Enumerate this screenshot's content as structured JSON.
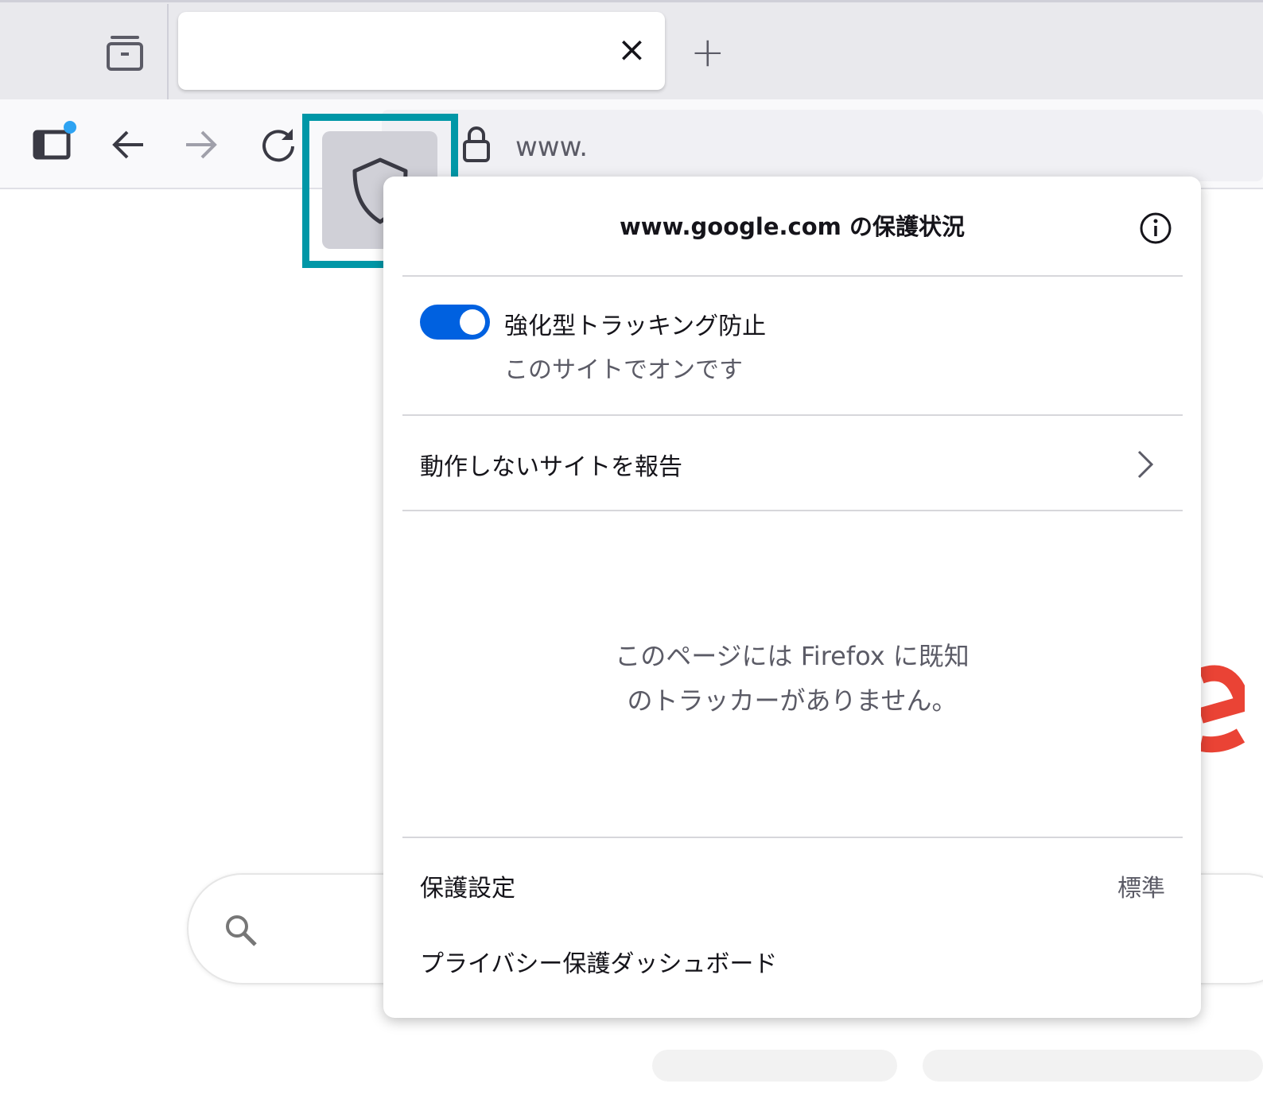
{
  "browser": {
    "tab": {
      "close_label": "×"
    },
    "new_tab_label": "+",
    "url_text": "www.",
    "colors": {
      "highlight": "#0097a7",
      "toggle": "#0061e0",
      "notification_dot": "#2ea3f2"
    }
  },
  "panel": {
    "title": "www.google.com の保護状況",
    "etp": {
      "label": "強化型トラッキング防止",
      "status": "このサイトでオンです",
      "enabled": true
    },
    "report_label": "動作しないサイトを報告",
    "empty_message_line1": "このページには Firefox に既知",
    "empty_message_line2": "のトラッカーがありません。",
    "settings_label": "保護設定",
    "settings_value": "標準",
    "dashboard_label": "プライバシー保護ダッシュボード"
  }
}
